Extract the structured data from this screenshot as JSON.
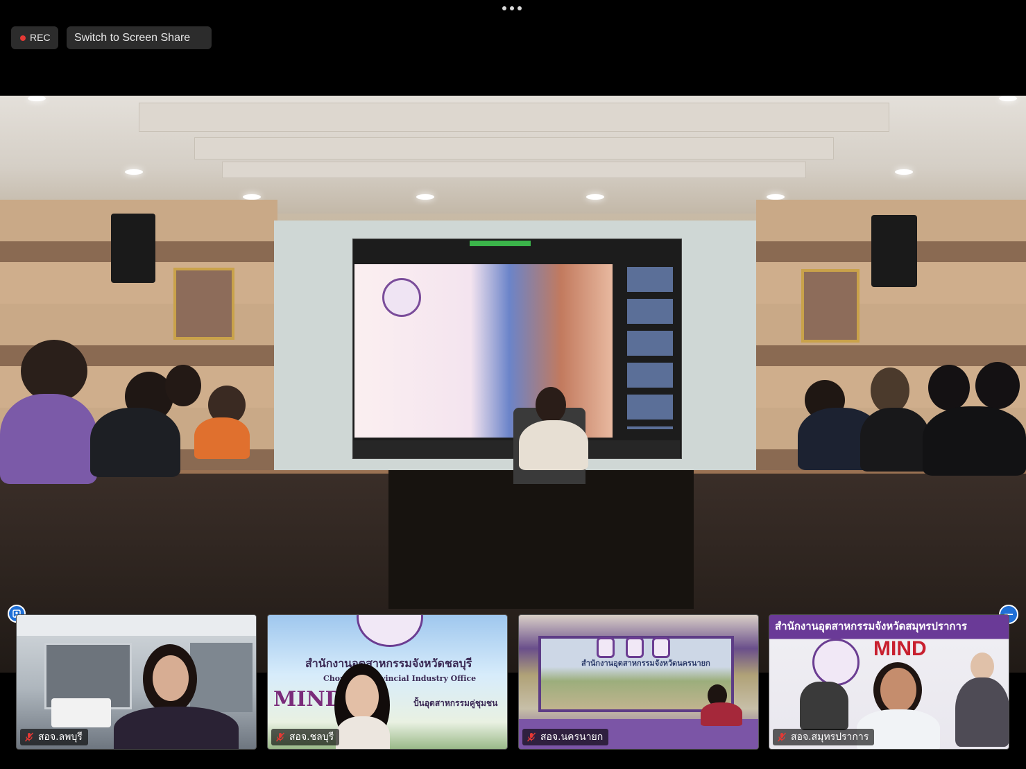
{
  "top_bar": {
    "more_icon": "more-dots-icon",
    "rec_label": "REC",
    "share_label": "Switch to Screen Share"
  },
  "colors": {
    "rec_dot": "#e53935",
    "accent": "#1f6fd6"
  },
  "main_video": {
    "description_icon": "active-speaker-video"
  },
  "tile2_texts": {
    "line1": "สำนักงานอุตสาหกรรมจังหวัดชลบุรี",
    "line2": "Chonburi Provincial Industry Office",
    "line3": "MIND",
    "line4": "ปั้นอุตสาหกรรมคู่ชุมชน"
  },
  "tile3_texts": {
    "banner": "สำนักงานอุตสาหกรรมจังหวัดนครนายก"
  },
  "tile4_texts": {
    "header": "สำนักงานอุตสาหกรรมจังหวัดสมุทรปราการ",
    "mind": "MIND"
  },
  "participants": [
    {
      "name": "สอจ.ลพบุรี",
      "muted": true
    },
    {
      "name": "สอจ.ชลบุรี",
      "muted": true
    },
    {
      "name": "สอจ.นครนายก",
      "muted": true
    },
    {
      "name": "สอจ.สมุทรปราการ",
      "muted": true
    }
  ]
}
